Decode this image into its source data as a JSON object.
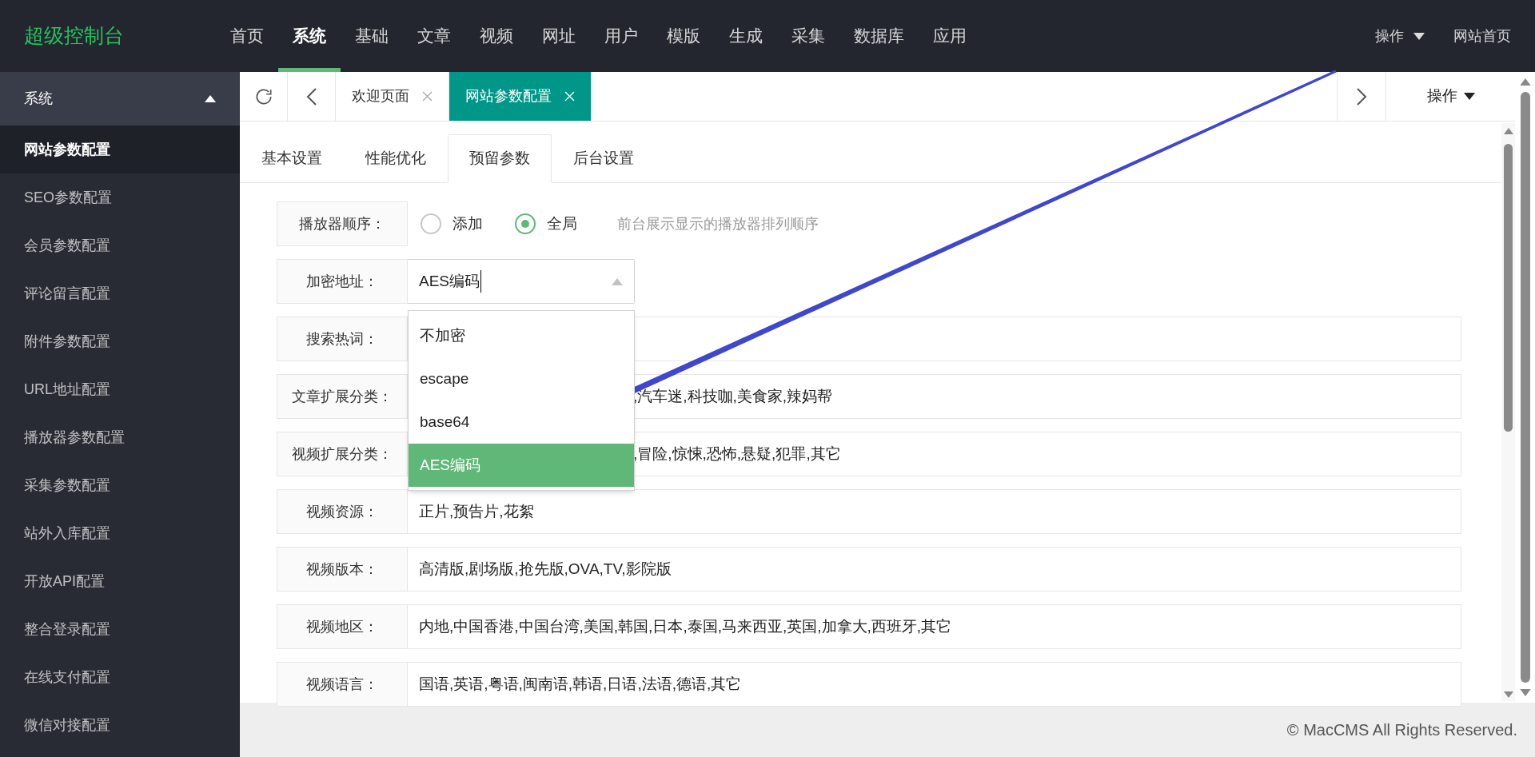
{
  "header": {
    "logo": "超级控制台",
    "nav": [
      {
        "label": "首页",
        "selected": false
      },
      {
        "label": "系统",
        "selected": true
      },
      {
        "label": "基础",
        "selected": false
      },
      {
        "label": "文章",
        "selected": false
      },
      {
        "label": "视频",
        "selected": false
      },
      {
        "label": "网址",
        "selected": false
      },
      {
        "label": "用户",
        "selected": false
      },
      {
        "label": "模版",
        "selected": false
      },
      {
        "label": "生成",
        "selected": false
      },
      {
        "label": "采集",
        "selected": false
      },
      {
        "label": "数据库",
        "selected": false
      },
      {
        "label": "应用",
        "selected": false
      }
    ],
    "actions_menu": "操作",
    "home_link": "网站首页"
  },
  "sidebar": {
    "group": {
      "label": "系统",
      "expanded": true
    },
    "items": [
      {
        "label": "网站参数配置",
        "selected": true
      },
      {
        "label": "SEO参数配置",
        "selected": false
      },
      {
        "label": "会员参数配置",
        "selected": false
      },
      {
        "label": "评论留言配置",
        "selected": false
      },
      {
        "label": "附件参数配置",
        "selected": false
      },
      {
        "label": "URL地址配置",
        "selected": false
      },
      {
        "label": "播放器参数配置",
        "selected": false
      },
      {
        "label": "采集参数配置",
        "selected": false
      },
      {
        "label": "站外入库配置",
        "selected": false
      },
      {
        "label": "开放API配置",
        "selected": false
      },
      {
        "label": "整合登录配置",
        "selected": false
      },
      {
        "label": "在线支付配置",
        "selected": false
      },
      {
        "label": "微信对接配置",
        "selected": false
      }
    ]
  },
  "page_tabs": {
    "tabs": [
      {
        "label": "欢迎页面",
        "selected": false
      },
      {
        "label": "网站参数配置",
        "selected": true
      }
    ],
    "actions_menu": "操作"
  },
  "sub_tabs": [
    {
      "label": "基本设置",
      "selected": false
    },
    {
      "label": "性能优化",
      "selected": false
    },
    {
      "label": "预留参数",
      "selected": true
    },
    {
      "label": "后台设置",
      "selected": false
    }
  ],
  "form": [
    {
      "kind": "radio",
      "label": "播放器顺序：",
      "options": [
        {
          "label": "添加",
          "selected": false
        },
        {
          "label": "全局",
          "selected": true
        }
      ],
      "hint": "前台展示显示的播放器排列顺序"
    },
    {
      "kind": "select",
      "label": "加密地址：",
      "value": "AES编码",
      "expanded": true,
      "options": [
        {
          "label": "不加密",
          "selected": false
        },
        {
          "label": "escape",
          "selected": false
        },
        {
          "label": "base64",
          "selected": false
        },
        {
          "label": "AES编码",
          "selected": true
        }
      ]
    },
    {
      "kind": "text",
      "label": "搜索热词："
    },
    {
      "kind": "covered_text",
      "label": "文章扩展分类：",
      "value": ",汽车迷,科技咖,美食家,辣妈帮"
    },
    {
      "kind": "covered_text",
      "label": "视频扩展分类：",
      "value": ",冒险,惊悚,恐怖,悬疑,犯罪,其它"
    },
    {
      "kind": "text",
      "label": "视频资源：",
      "value": "正片,预告片,花絮"
    },
    {
      "kind": "text",
      "label": "视频版本：",
      "value": "高清版,剧场版,抢先版,OVA,TV,影院版"
    },
    {
      "kind": "text",
      "label": "视频地区：",
      "value": "内地,中国香港,中国台湾,美国,韩国,日本,泰国,马来西亚,英国,加拿大,西班牙,其它"
    },
    {
      "kind": "text",
      "label": "视频语言：",
      "value": "国语,英语,粤语,闽南语,韩语,日语,法语,德语,其它"
    }
  ],
  "footer": "© MacCMS All Rights Reserved."
}
